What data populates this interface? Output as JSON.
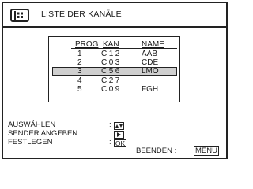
{
  "header": {
    "title": "LISTE DER KANÄLE",
    "menu_icon": "menu-list-icon"
  },
  "channel_list": {
    "columns": [
      "PROG",
      "KAN",
      "NAME"
    ],
    "rows": [
      {
        "prog": "1",
        "kan": "C12",
        "name": "AAB"
      },
      {
        "prog": "2",
        "kan": "C03",
        "name": "CDE"
      },
      {
        "prog": "3",
        "kan": "C56",
        "name": "LMO"
      },
      {
        "prog": "4",
        "kan": "C27",
        "name": ""
      },
      {
        "prog": "5",
        "kan": "C09",
        "name": "FGH"
      }
    ],
    "selected_row_index": 2
  },
  "controls": {
    "select_label": "AUSWÄHLEN",
    "select_icon": "up-down-arrows-icon",
    "name_label": "SENDER ANGEBEN",
    "name_icon": "right-arrow-icon",
    "confirm_label": "FESTLEGEN",
    "confirm_key": "OK",
    "colon": ":"
  },
  "footer": {
    "exit_label": "BEENDEN :",
    "exit_key": "MENU"
  }
}
